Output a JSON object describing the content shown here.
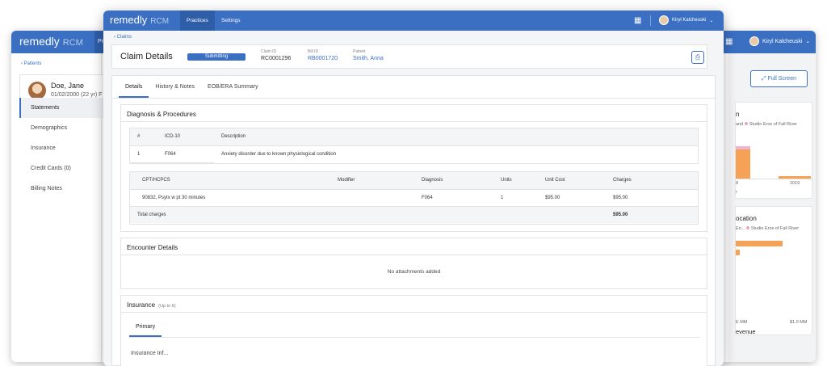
{
  "back_window": {
    "logo_main": "remedly",
    "logo_sub": "RCM",
    "nav_partial": "Pr",
    "user_name": "Kiryl Kalcheuski",
    "back_link": "‹  Patients",
    "patient_name": "Doe, Jane",
    "patient_dob": "01/02/2000 (22 yr) F",
    "menu": [
      "Statements",
      "Demographics",
      "Insurance",
      "Credit Cards (0)",
      "Billing Notes"
    ],
    "full_screen_label": "Full Screen",
    "card1": {
      "title": "n",
      "legend_a": "and",
      "legend_b": "Studio Eros of Fall River",
      "x_label_a": "8",
      "x_label_b": "2019",
      "x_label_c": "r"
    },
    "card2": {
      "title": "ocation",
      "legend_a": "En...",
      "legend_b": "Studio Eros of Fall River",
      "axis_a": "E MM",
      "axis_b": "$1.0 MM",
      "caption": "evenue"
    },
    "accent": "#3a6fc1"
  },
  "front_window": {
    "logo_main": "remedly",
    "logo_sub": "RCM",
    "nav": [
      {
        "label": "Practices"
      },
      {
        "label": "Settings"
      }
    ],
    "user_name": "Kiryl Kalcheuski",
    "breadcrumb": "‹  Claims",
    "header": {
      "title": "Claim Details",
      "status": "Submitting",
      "claim_id_label": "Claim ID",
      "claim_id": "RC0001296",
      "bill_id_label": "Bill ID",
      "bill_id": "RB0001720",
      "patient_label": "Patient",
      "patient": "Smith, Anna"
    },
    "tabs": [
      "Details",
      "History & Notes",
      "EOB/ERA Summary"
    ],
    "diagnosis": {
      "title": "Diagnosis & Procedures",
      "icd_headers": [
        "#",
        "ICD-10",
        "Description"
      ],
      "icd_rows": [
        [
          "1",
          "F064",
          "Anxiety disorder due to known physiological condition"
        ]
      ],
      "proc_headers": [
        "CPT/HCPCS",
        "Modifier",
        "Diagnosis",
        "Units",
        "Unit Cost",
        "Charges"
      ],
      "proc_rows": [
        [
          "90832,  Psytx w pt 30 minutes",
          "",
          "F064",
          "1",
          "$95.00",
          "$95.00"
        ]
      ],
      "total_label": "Total charges",
      "total_value": "$95.00"
    },
    "encounter": {
      "title": "Encounter Details",
      "empty": "No attachments added"
    },
    "insurance": {
      "title": "Insurance",
      "hint": "(Up to 6)",
      "tab": "Primary",
      "partial": "Insurance Inf..."
    }
  }
}
